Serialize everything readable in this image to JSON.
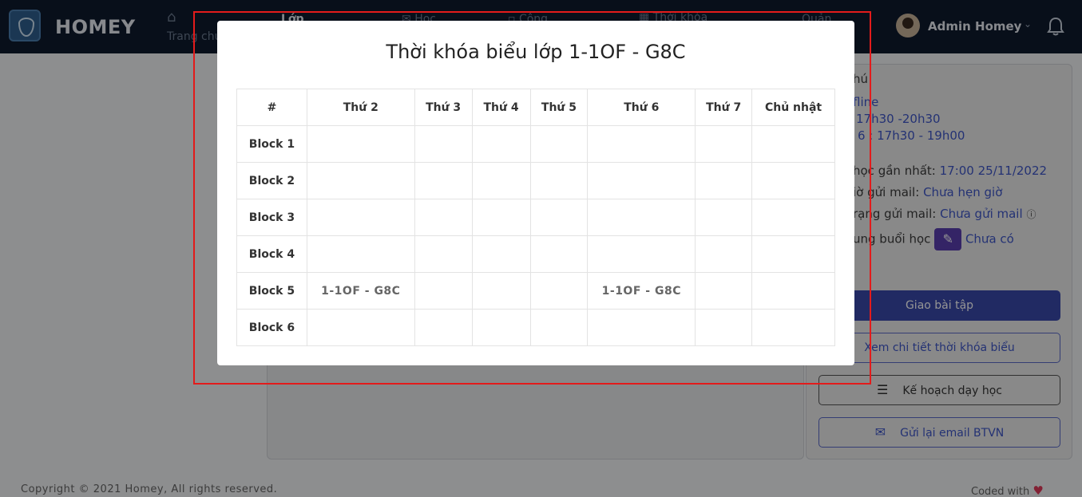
{
  "navbar": {
    "brand": "HOMEY",
    "items": [
      {
        "label": "Trang chủ",
        "icon": "home-icon"
      },
      {
        "label": "Lớp",
        "icon": "class-icon"
      },
      {
        "label": "Học",
        "icon": "study-icon"
      },
      {
        "label": "Công",
        "icon": "work-icon"
      },
      {
        "label": "Thời khóa",
        "icon": "calendar-icon"
      },
      {
        "label": "Quản",
        "icon": "manage-icon"
      }
    ],
    "user_name": "Admin Homey"
  },
  "sidebar": {
    "chu_label": "hú",
    "online_label": "fline",
    "schedule_1": "17h30 -20h30",
    "schedule_2": "6 : 17h30 - 19h00",
    "next_session_label": "học gần nhất:",
    "next_session_value": "17:00 25/11/2022",
    "mail_time_label": "iờ gửi mail:",
    "mail_time_value": "Chưa hẹn giờ",
    "mail_status_label": "rạng gửi mail:",
    "mail_status_value": "Chưa gửi mail",
    "content_label": "ung buổi học",
    "content_value": "Chưa có",
    "buttons": {
      "assign": "Giao bài tập",
      "view_schedule": "Xem chi tiết thời khóa biểu",
      "plan": "Kế hoạch dạy học",
      "resend": "Gửi lại email BTVN"
    }
  },
  "footer": {
    "copyright": "Copyright © 2021 Homey, All rights reserved.",
    "coded_with": "Coded with"
  },
  "modal": {
    "title": "Thời khóa biểu lớp 1-1OF - G8C",
    "headers": [
      "#",
      "Thứ 2",
      "Thứ 3",
      "Thứ 4",
      "Thứ 5",
      "Thứ 6",
      "Thứ 7",
      "Chủ nhật"
    ],
    "rows": [
      {
        "block": "Block 1",
        "cells": [
          "",
          "",
          "",
          "",
          "",
          "",
          ""
        ]
      },
      {
        "block": "Block 2",
        "cells": [
          "",
          "",
          "",
          "",
          "",
          "",
          ""
        ]
      },
      {
        "block": "Block 3",
        "cells": [
          "",
          "",
          "",
          "",
          "",
          "",
          ""
        ]
      },
      {
        "block": "Block 4",
        "cells": [
          "",
          "",
          "",
          "",
          "",
          "",
          ""
        ]
      },
      {
        "block": "Block 5",
        "cells": [
          "1-1OF - G8C",
          "",
          "",
          "",
          "1-1OF - G8C",
          "",
          ""
        ]
      },
      {
        "block": "Block 6",
        "cells": [
          "",
          "",
          "",
          "",
          "",
          "",
          ""
        ]
      }
    ]
  },
  "colors": {
    "navbar_bg": "#0f1a2e",
    "accent": "#3949ab",
    "highlight": "#e31b1b"
  }
}
